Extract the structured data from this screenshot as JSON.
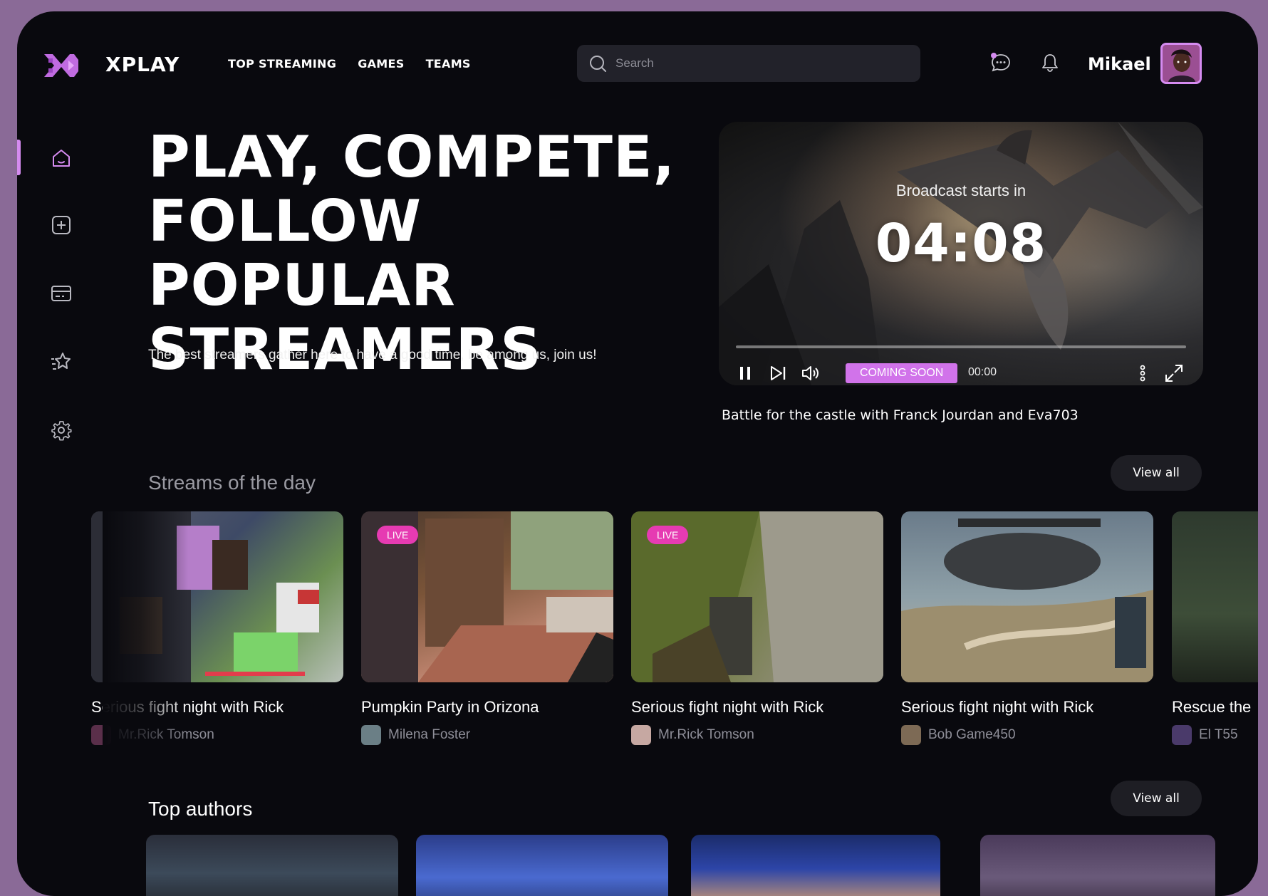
{
  "brand": {
    "name": "XPLAY"
  },
  "nav": [
    {
      "label": "TOP STREAMING"
    },
    {
      "label": "GAMES"
    },
    {
      "label": "TEAMS"
    }
  ],
  "search": {
    "placeholder": "Search",
    "value": ""
  },
  "user": {
    "name": "Mikael"
  },
  "sidebar": {
    "items": [
      {
        "icon": "home-icon",
        "active": true
      },
      {
        "icon": "plus-square-icon",
        "active": false
      },
      {
        "icon": "card-icon",
        "active": false
      },
      {
        "icon": "stars-icon",
        "active": false
      },
      {
        "icon": "gear-icon",
        "active": false
      }
    ]
  },
  "hero": {
    "title_lines": [
      "PLAY, COMPETE,",
      "FOLLOW POPULAR",
      "STREAMERS"
    ],
    "subtitle": "The best streamers gather here to have a good time, be among us, join us!"
  },
  "video": {
    "broadcast_label": "Broadcast starts in",
    "countdown": "04:08",
    "badge": "COMING SOON",
    "time": "00:00",
    "progress": 0,
    "caption": "Battle for the castle with Franck Jourdan and Eva703"
  },
  "streams": {
    "title": "Streams of the day",
    "view_all": "View all",
    "cards": [
      {
        "title": "Serious fight night with Rick",
        "author": "Mr.Rick Tomson",
        "live": false
      },
      {
        "title": "Pumpkin Party in Orizona",
        "author": "Milena Foster",
        "live": true
      },
      {
        "title": "Serious fight night with Rick",
        "author": "Mr.Rick Tomson",
        "live": true
      },
      {
        "title": "Serious fight night with Rick",
        "author": "Bob Game450",
        "live": false
      },
      {
        "title": "Rescue the",
        "author": "El T55",
        "live": false
      }
    ],
    "live_label": "LIVE"
  },
  "authors": {
    "title": "Top authors",
    "view_all": "View all"
  },
  "colors": {
    "accent": "#d58bf0",
    "live": "#e63bb2",
    "badge": "#d173ea",
    "background": "#09090e"
  }
}
